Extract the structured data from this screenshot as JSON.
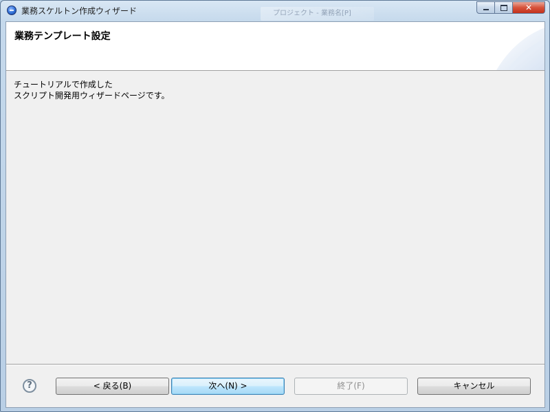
{
  "window": {
    "title": "業務スケルトン作成ウィザード",
    "background_window_title": "プロジェクト - 業務名[P]"
  },
  "banner": {
    "title": "業務テンプレート設定"
  },
  "description": "チュートリアルで作成した\nスクリプト開発用ウィザードページです。",
  "buttons": {
    "help_icon": "?",
    "back": "< 戻る(B)",
    "next": "次へ(N) >",
    "finish": "終了(F)",
    "cancel": "キャンセル",
    "finish_enabled": false
  },
  "colors": {
    "dialog_bg": "#f0f0f0",
    "banner_bg": "#ffffff",
    "default_button_border": "#3c7fb1",
    "disabled_text": "#8d8d8d"
  },
  "icons": {
    "app": "eclipse-app-icon",
    "help": "help-icon",
    "minimize": "minimize-icon",
    "maximize": "maximize-icon",
    "close": "close-icon"
  }
}
